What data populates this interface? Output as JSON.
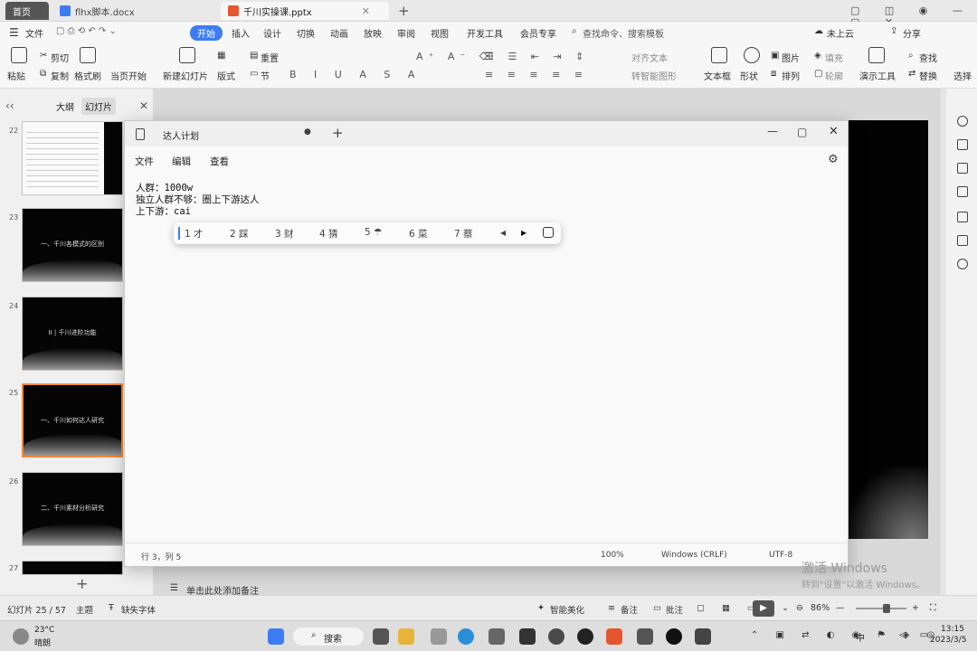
{
  "tabs": [
    {
      "label": "首页"
    },
    {
      "label": "flhx脚本.docx"
    },
    {
      "label": "千川实操课.pptx"
    }
  ],
  "menu": [
    "文件",
    "开始",
    "插入",
    "设计",
    "切换",
    "动画",
    "放映",
    "审阅",
    "视图",
    "开发工具",
    "会员专享"
  ],
  "search_placeholder": "查找命令、搜索模板",
  "menu_right": [
    "未上云",
    "分享"
  ],
  "ribbon": {
    "paste": "粘贴",
    "cut": "剪切",
    "copy": "复制",
    "format_painter": "格式刷",
    "play_from_current": "当页开始",
    "new_slide": "新建幻灯片",
    "layout": "版式",
    "reset": "重置",
    "section": "节",
    "align_text": "对齐文本",
    "smart_art": "转智能图形",
    "textbox": "文本框",
    "shape": "形状",
    "picture": "图片",
    "arrange": "排列",
    "fill": "填充",
    "outline": "轮廓",
    "presentation_tools": "演示工具",
    "find": "查找",
    "replace": "替换",
    "select": "选择"
  },
  "panel_tabs": [
    "大纲",
    "幻灯片"
  ],
  "thumbnails": [
    {
      "num": "22",
      "title": ""
    },
    {
      "num": "23",
      "title": "一、千川各模式的区别"
    },
    {
      "num": "24",
      "title": "II | 千川进阶功能"
    },
    {
      "num": "25",
      "title": "一、千川如何达人研究"
    },
    {
      "num": "26",
      "title": "二、千川素材分析研究"
    },
    {
      "num": "27",
      "title": ""
    }
  ],
  "notepad": {
    "title": "达人计划",
    "menu": [
      "文件",
      "编辑",
      "查看"
    ],
    "lines": [
      "人群：1000w",
      "独立人群不够：圈上下游达人",
      "上下游：cai"
    ],
    "status": {
      "position": "行 3，列 5",
      "zoom": "100%",
      "line_ending": "Windows (CRLF)",
      "encoding": "UTF-8"
    }
  },
  "ime_candidates": [
    "1 才",
    "2 踩",
    "3 财",
    "4 猜",
    "5 ☂",
    "6 菜",
    "7 蔡"
  ],
  "notes_placeholder": "单击此处添加备注",
  "statusbar": {
    "slide_info": "幻灯片 25 / 57",
    "theme": "主题",
    "missing_font": "缺失字体",
    "beautify": "智能美化",
    "notes": "备注",
    "comments": "批注",
    "zoom": "86%"
  },
  "watermark": [
    "激活 Windows",
    "转到\"设置\"以激活 Windows。"
  ],
  "taskbar": {
    "weather_temp": "23°C",
    "weather_desc": "晴朗",
    "search": "搜索",
    "ime_lang": "中",
    "time": "13:15",
    "date": "2023/3/5"
  }
}
